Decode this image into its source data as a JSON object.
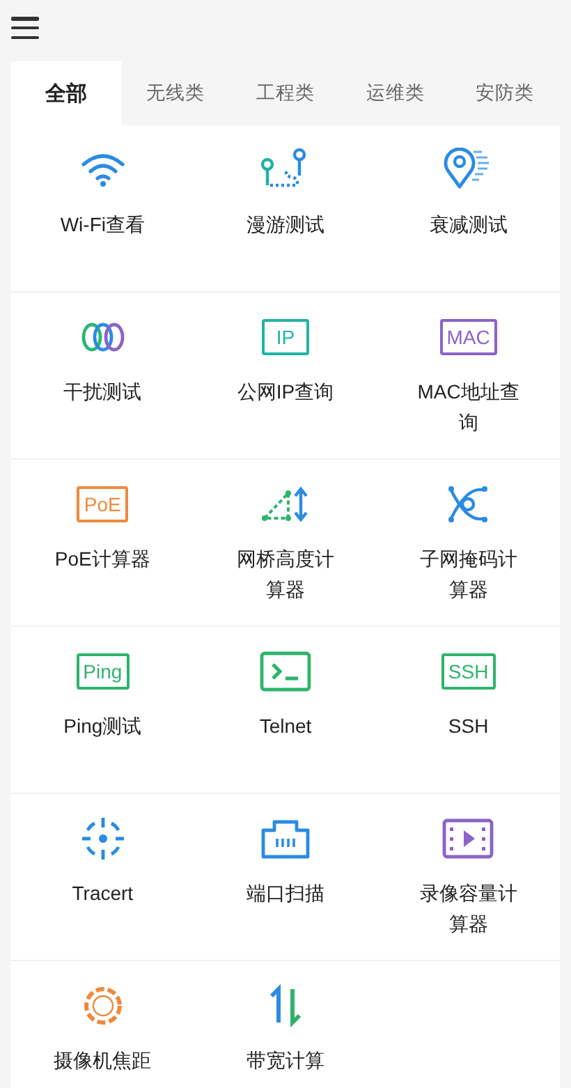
{
  "tabs": [
    {
      "label": "全部",
      "selected": true
    },
    {
      "label": "无线类",
      "selected": false
    },
    {
      "label": "工程类",
      "selected": false
    },
    {
      "label": "运维类",
      "selected": false
    },
    {
      "label": "安防类",
      "selected": false
    }
  ],
  "tools": [
    {
      "label": "Wi-Fi查看",
      "kind": "wifi"
    },
    {
      "label": "漫游测试",
      "kind": "roaming"
    },
    {
      "label": "衰减测试",
      "kind": "attenuation"
    },
    {
      "label": "干扰测试",
      "kind": "interference"
    },
    {
      "label": "公网IP查询",
      "kind": "badge",
      "badge": "IP",
      "color": "#22b3a6"
    },
    {
      "label": "MAC地址查询",
      "kind": "badge",
      "badge": "MAC",
      "color": "#8b63c9"
    },
    {
      "label": "PoE计算器",
      "kind": "badge",
      "badge": "PoE",
      "color": "#ee8a3c"
    },
    {
      "label": "网桥高度计算器",
      "kind": "bridge"
    },
    {
      "label": "子网掩码计算器",
      "kind": "subnet"
    },
    {
      "label": "Ping测试",
      "kind": "badge",
      "badge": "Ping",
      "color": "#2fb36c"
    },
    {
      "label": "Telnet",
      "kind": "terminal"
    },
    {
      "label": "SSH",
      "kind": "badge",
      "badge": "SSH",
      "color": "#2fb36c"
    },
    {
      "label": "Tracert",
      "kind": "target"
    },
    {
      "label": "端口扫描",
      "kind": "port"
    },
    {
      "label": "录像容量计算器",
      "kind": "video"
    },
    {
      "label": "摄像机焦距",
      "kind": "aperture"
    },
    {
      "label": "带宽计算",
      "kind": "bandwidth"
    }
  ]
}
